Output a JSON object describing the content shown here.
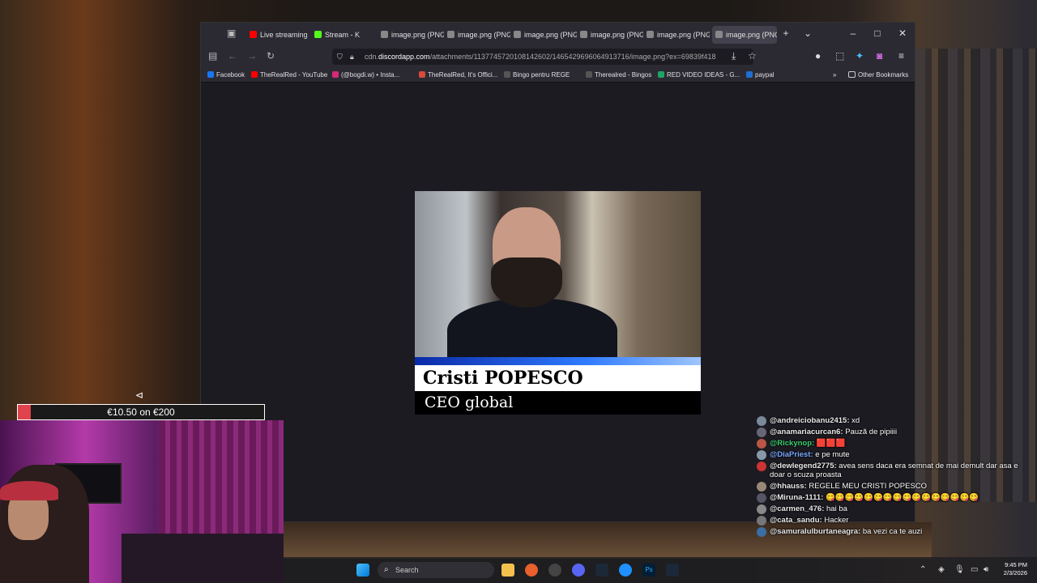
{
  "browser": {
    "tabs": [
      {
        "label": "Live streaming",
        "icon": "youtube-icon",
        "color": "#ff0000"
      },
      {
        "label": "Stream - K",
        "icon": "kick-icon",
        "color": "#53fc18"
      },
      {
        "label": "image.png (PNG In",
        "icon": "image-icon",
        "color": "#888888"
      },
      {
        "label": "image.png (PNG In",
        "icon": "image-icon",
        "color": "#888888"
      },
      {
        "label": "image.png (PNG In",
        "icon": "image-icon",
        "color": "#888888"
      },
      {
        "label": "image.png (PNG In",
        "icon": "image-icon",
        "color": "#888888"
      },
      {
        "label": "image.png (PNG In",
        "icon": "image-icon",
        "color": "#888888"
      },
      {
        "label": "image.png (PNG",
        "icon": "image-icon",
        "color": "#888888",
        "active": true
      }
    ],
    "url_prefix": "cdn.",
    "url_domain": "discordapp.com",
    "url_rest": "/attachments/1137745720108142602/1465429696064913716/image.png?ex=69839f418",
    "bookmarks": [
      {
        "label": "Facebook",
        "color": "#1877f2"
      },
      {
        "label": "TheRealRed - YouTube",
        "color": "#ff0000"
      },
      {
        "label": "(@bogdi.w) • Insta...",
        "color": "#d62976"
      },
      {
        "label": "TheRealRed, It's Offici...",
        "color": "#d84a3a"
      },
      {
        "label": "Bingo pentru REGE",
        "color": "#555555"
      },
      {
        "label": "Therealred - Bingos",
        "color": "#555555"
      },
      {
        "label": "RED VIDEO IDEAS - G...",
        "color": "#1fa463"
      },
      {
        "label": "paypal",
        "color": "#1f6fd0"
      }
    ],
    "other_bookmarks": "Other Bookmarks"
  },
  "lower_third": {
    "name": "Cristi POPESCO",
    "title": "CEO global"
  },
  "donation": {
    "label": "€10.50 on €200",
    "progress": 0.0525,
    "color": "#e0434b"
  },
  "chat": [
    {
      "user": "@andreiciobanu2415:",
      "text": "xd",
      "color": "#e8e8e8"
    },
    {
      "user": "@anamariacurcan6:",
      "text": "Pauză de pipiiii",
      "color": "#e8e8e8"
    },
    {
      "user": "@Rickynop:",
      "text": "🟥🟥🟥",
      "color": "#3cd070"
    },
    {
      "user": "@DiaPriest:",
      "text": "e pe mute",
      "color": "#7aa8ff"
    },
    {
      "user": "@dewlegend2775:",
      "text": "avea sens daca era semnat de mai demult dar asa e doar o scuza proasta",
      "color": "#e8e8e8"
    },
    {
      "user": "@hhauss:",
      "text": "REGELE MEU CRISTI POPESCO",
      "color": "#e8e8e8"
    },
    {
      "user": "@Miruna-1111:",
      "text": "😋😋😋😋😋😋😋😋😋😋😋😋😋😋😋😋",
      "color": "#e8e8e8"
    },
    {
      "user": "@carmen_476:",
      "text": "hai ba",
      "color": "#e8e8e8"
    },
    {
      "user": "@cata_sandu:",
      "text": "Hacker",
      "color": "#e8e8e8"
    },
    {
      "user": "@samuralulburtaneagra:",
      "text": "ba vezi ca te auzi",
      "color": "#e8e8e8"
    }
  ],
  "taskbar": {
    "search": "Search",
    "time": "9:45 PM",
    "date": "2/3/2026"
  }
}
